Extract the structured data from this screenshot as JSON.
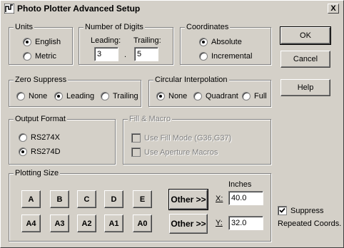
{
  "window": {
    "title": "Photo Plotter Advanced Setup",
    "close_glyph": "X"
  },
  "units": {
    "legend": "Units",
    "options": [
      "English",
      "Metric"
    ],
    "selected": "English"
  },
  "digits": {
    "legend": "Number of Digits",
    "leading_label": "Leading:",
    "trailing_label": "Trailing:",
    "leading_value": "3",
    "trailing_value": "5",
    "separator": "."
  },
  "coordinates": {
    "legend": "Coordinates",
    "options": [
      "Absolute",
      "Incremental"
    ],
    "selected": "Absolute"
  },
  "zero_suppress": {
    "legend": "Zero Suppress",
    "options": [
      "None",
      "Leading",
      "Trailing"
    ],
    "selected": "Leading"
  },
  "circular": {
    "legend": "Circular Interpolation",
    "options": [
      "None",
      "Quadrant",
      "Full"
    ],
    "selected": "None"
  },
  "output_format": {
    "legend": "Output Format",
    "options": [
      "RS274X",
      "RS274D"
    ],
    "selected": "RS274D"
  },
  "fill_macro": {
    "legend": "Fill & Macro",
    "use_fill_mode": "Use Fill Mode (G36,G37)",
    "use_aperture_macros": "Use Aperture Macros"
  },
  "plotting_size": {
    "legend": "Plotting Size",
    "row1": [
      "A",
      "B",
      "C",
      "D",
      "E"
    ],
    "row2": [
      "A4",
      "A3",
      "A2",
      "A1",
      "A0"
    ],
    "other_label": "Other >>",
    "inches_label": "Inches",
    "x_label": "X:",
    "y_label": "Y:",
    "x_value": "40.0",
    "y_value": "32.0"
  },
  "suppress": {
    "label": "Suppress",
    "label2": "Repeated Coords.",
    "checked": true
  },
  "buttons": {
    "ok": "OK",
    "cancel": "Cancel",
    "help": "Help"
  }
}
